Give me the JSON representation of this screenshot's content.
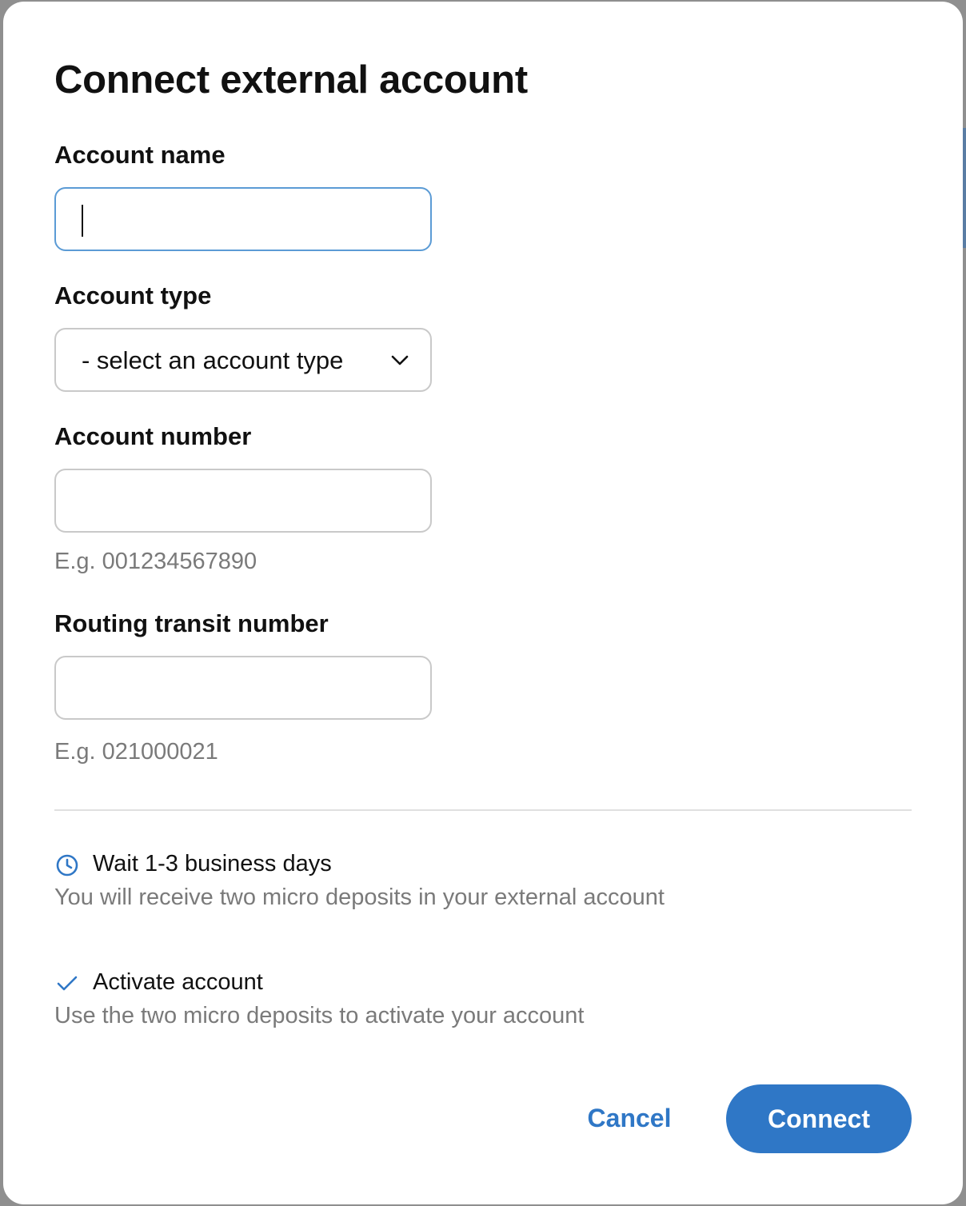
{
  "dialog": {
    "title": "Connect external account"
  },
  "form": {
    "account_name": {
      "label": "Account name",
      "value": ""
    },
    "account_type": {
      "label": "Account type",
      "selected": "- select an account type"
    },
    "account_number": {
      "label": "Account number",
      "value": "",
      "hint": "E.g. 001234567890"
    },
    "routing_number": {
      "label": "Routing transit number",
      "value": "",
      "hint": "E.g. 021000021"
    }
  },
  "steps": [
    {
      "icon": "clock-icon",
      "title": "Wait 1-3 business days",
      "description": "You will receive two micro deposits in your external account"
    },
    {
      "icon": "checkmark-icon",
      "title": "Activate account",
      "description": "Use the two micro deposits to activate your account"
    }
  ],
  "actions": {
    "cancel_label": "Cancel",
    "connect_label": "Connect"
  },
  "colors": {
    "accent": "#2f77c6",
    "focus_border": "#5b9bd5",
    "hint_text": "#7a7a7a"
  }
}
